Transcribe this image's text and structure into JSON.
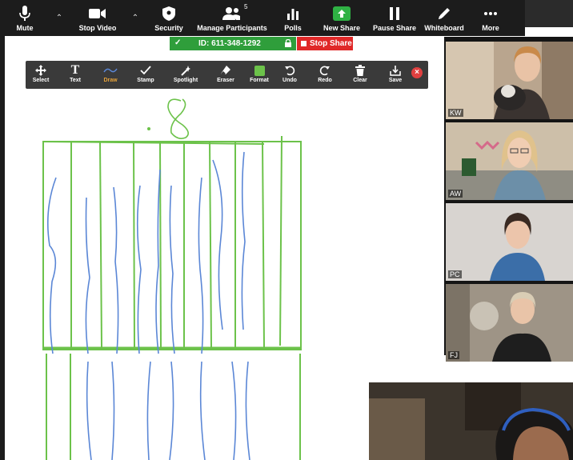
{
  "toolbar": {
    "mute": "Mute",
    "stop_video": "Stop Video",
    "security": "Security",
    "manage_participants": "Manage Participants",
    "participant_count": "5",
    "polls": "Polls",
    "new_share": "New Share",
    "pause_share": "Pause Share",
    "whiteboard": "Whiteboard",
    "more": "More"
  },
  "meeting": {
    "id_text": "ID: 611-348-1292",
    "stop_share": "Stop Share"
  },
  "annotation": {
    "select": "Select",
    "text": "Text",
    "draw": "Draw",
    "stamp": "Stamp",
    "spotlight": "Spotlight",
    "eraser": "Eraser",
    "format": "Format",
    "undo": "Undo",
    "redo": "Redo",
    "clear": "Clear",
    "save": "Save",
    "active_tool": "Draw"
  },
  "whiteboard": {
    "written_number": ".8"
  },
  "participants": [
    {
      "initials": "KW"
    },
    {
      "initials": "AW"
    },
    {
      "initials": "PC"
    },
    {
      "initials": "FJ"
    }
  ],
  "colors": {
    "toolbar_bg": "#1c1c1c",
    "meeting_id_bg": "#2f9e3b",
    "stop_share_bg": "#e02828",
    "new_share_green": "#2fb144",
    "draw_active": "#e7a33a",
    "pen_green": "#6cc24a",
    "pen_blue": "#5b87d6"
  }
}
